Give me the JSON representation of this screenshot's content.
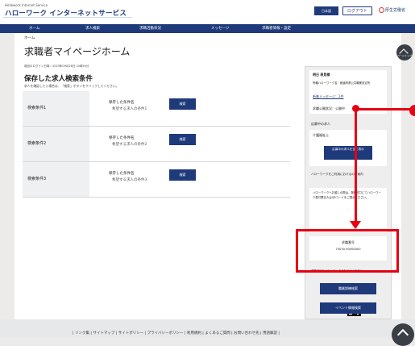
{
  "header": {
    "logo_top": "Hellowork Internet Service",
    "logo_main": "ハローワーク インターネットサービス",
    "badge": "日本語",
    "logout_label": "ログアウト",
    "ministry": "厚生労働省"
  },
  "nav": {
    "items": [
      "ホーム",
      "求人検索",
      "求職活動状況",
      "メッセージ",
      "求職者情報・設定"
    ]
  },
  "breadcrumb": "ホーム",
  "page_title": "求職者マイページホーム",
  "last_login": "前回のログイン日時：2023年09月26日 10時50分",
  "saved_search": {
    "title": "保存した求人検索条件",
    "subtitle": "求人を確認したい場合は、「検索」ボタンをクリックしてください。",
    "rows": [
      {
        "label": "検索条件1",
        "line1": "保存した条件名",
        "line2": "希望する求人の条件1",
        "button": "検索"
      },
      {
        "label": "検索条件2",
        "line1": "保存した条件名",
        "line2": "希望する求人の条件2",
        "button": "検索"
      },
      {
        "label": "検索条件3",
        "line1": "保存した条件名",
        "line2": "希望する求人の条件3",
        "button": "検索"
      }
    ]
  },
  "right_panel": {
    "user_name": "明日 表見様",
    "office": "所轄ハローワーク名：都道府県公共職業安定所",
    "new_messages": "新着メッセージ：1件",
    "public_status": "求職公開状況：公開中",
    "applied_title": "応募中の求人",
    "applied_item": "介護福祉士",
    "show_all_button": "応募中の求人を全て表示",
    "hw_use_title": "ハローワークをご利用におけるのご案内",
    "hw_use_text": "ハローワークへお越しの際は、登録窓口にてハローワーク受付票またはQRコードをご提示ください。",
    "job_number_label": "求職番号",
    "job_number": "75030-90000000",
    "card_note": "求職番号をハローワークでお伝えください。",
    "job_search_button": "職業訓練検索",
    "event_button": "イベント情報検索"
  },
  "scroll_top_label": "ページトップ",
  "footer": {
    "links": "| リンク集 | サイトマップ | サイトポリシー | プライバシーポリシー | 利用規約 | よくあるご質問 | お問い合わせ先 | 用語解説 |"
  },
  "colors": {
    "brand": "#1f3a7a",
    "highlight": "#e60012"
  }
}
